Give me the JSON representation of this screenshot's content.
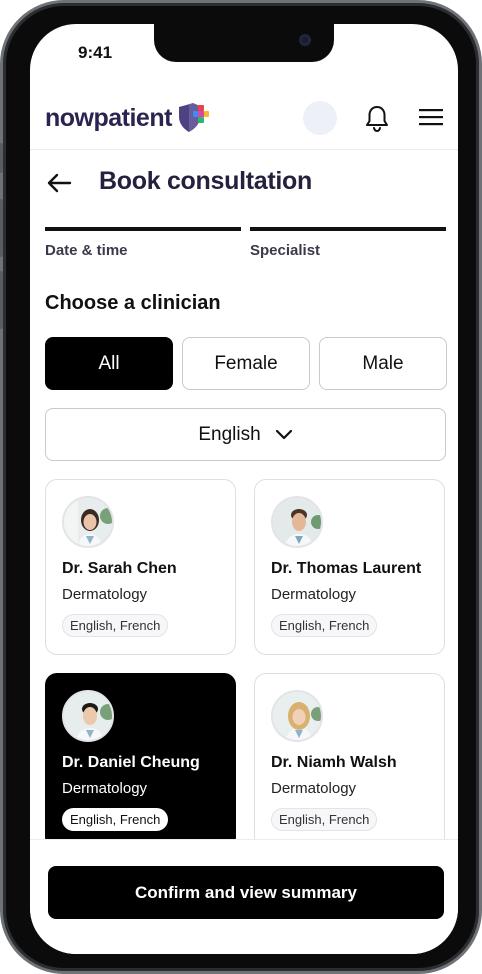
{
  "status": {
    "time": "9:41"
  },
  "brand": {
    "logo_text": "nowpatient",
    "logo_colors": {
      "text": "#2C2350",
      "shield": "#6A5B9B",
      "plus_red": "#E8424F",
      "plus_yellow": "#F5B82E",
      "plus_green": "#2BB673",
      "plus_blue": "#3D8BFD",
      "plus_pink": "#D64AA6"
    }
  },
  "header": {
    "avatar": "user-avatar",
    "bell": "bell-icon",
    "menu": "hamburger-menu-icon"
  },
  "page": {
    "title": "Book consultation",
    "back": "back-arrow-icon"
  },
  "steps": [
    {
      "label": "Date & time",
      "completed": true
    },
    {
      "label": "Specialist",
      "completed": true
    }
  ],
  "section": {
    "title": "Choose a clinician"
  },
  "filters": {
    "gender": [
      "All",
      "Female",
      "Male"
    ],
    "gender_selected": "All",
    "language": {
      "value": "English",
      "icon": "chevron-down-icon"
    }
  },
  "clinicians": [
    {
      "name": "Dr. Sarah Chen",
      "specialty": "Dermatology",
      "languages": "English, French",
      "selected": false
    },
    {
      "name": "Dr. Thomas Laurent",
      "specialty": "Dermatology",
      "languages": "English, French",
      "selected": false
    },
    {
      "name": "Dr. Daniel Cheung",
      "specialty": "Dermatology",
      "languages": "English, French",
      "selected": true
    },
    {
      "name": "Dr. Niamh Walsh",
      "specialty": "Dermatology",
      "languages": "English, French",
      "selected": false
    }
  ],
  "cta": {
    "label": "Confirm and view summary"
  }
}
